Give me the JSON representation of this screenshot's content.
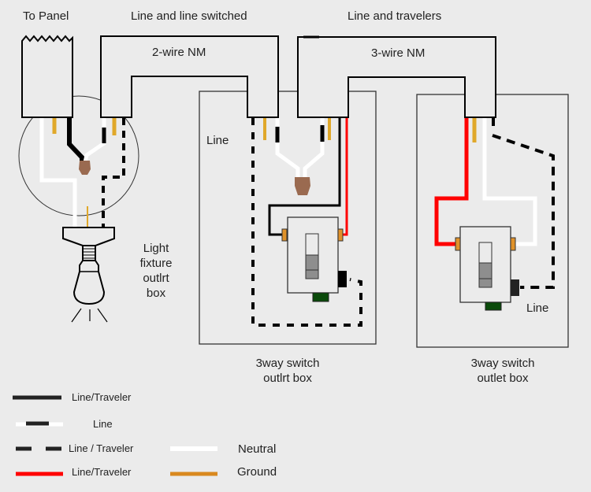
{
  "title_labels": {
    "to_panel": "To Panel",
    "cable1_purpose": "Line and line switched",
    "cable1_type": "2-wire NM",
    "cable2_purpose": "Line and travelers",
    "cable2_type": "3-wire NM"
  },
  "boxes": {
    "light": {
      "line1": "Light",
      "line2": "fixture",
      "line3": "outlrt",
      "line4": "box"
    },
    "switch1": {
      "label_line": "Line",
      "caption1": "3way switch",
      "caption2": "outlrt box"
    },
    "switch2": {
      "label_line": "Line",
      "caption1": "3way switch",
      "caption2": "outlet box"
    }
  },
  "legend": [
    {
      "style": "solid-black",
      "label": "Line/Traveler"
    },
    {
      "style": "white-with-black-tape",
      "label": "Line"
    },
    {
      "style": "dashed-black",
      "label": "Line / Traveler"
    },
    {
      "style": "solid-red",
      "label": "Line/Traveler"
    },
    {
      "style": "solid-white",
      "label": "Neutral"
    },
    {
      "style": "solid-orange",
      "label": "Ground"
    }
  ],
  "colors": {
    "background": "#ebebeb",
    "black_wire": "#000000",
    "red_wire": "#ff0000",
    "white_wire": "#ffffff",
    "ground_wire": "#e0a82a",
    "ground_legend": "#d9891f",
    "wire_nut": "#9a6a50",
    "terminal": "#e0922a",
    "ground_screw": "#0a4a0a"
  }
}
